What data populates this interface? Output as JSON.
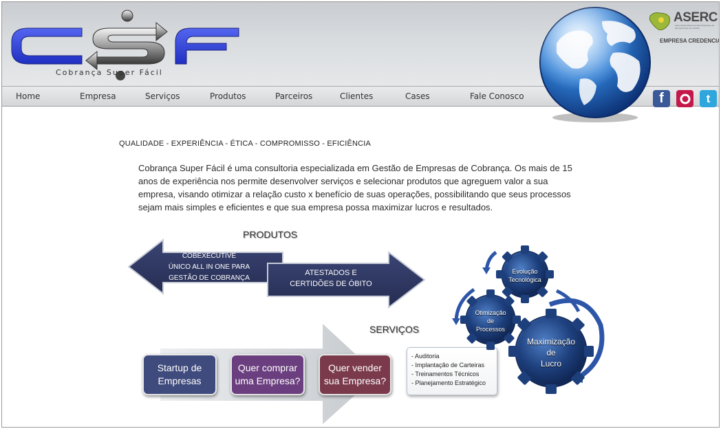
{
  "logo": {
    "letters": "CSF",
    "tagline": "Cobrança Super Fácil"
  },
  "nav": [
    {
      "label": "Home"
    },
    {
      "label": "Empresa"
    },
    {
      "label": "Serviços"
    },
    {
      "label": "Produtos"
    },
    {
      "label": "Parceiros"
    },
    {
      "label": "Clientes"
    },
    {
      "label": "Cases"
    },
    {
      "label": "Fale Conosco"
    }
  ],
  "badge": {
    "name": "ASERC",
    "subtitle": "Associação Nacional das Empresas de Recuperação de Crédito",
    "credential": "EMPRESA CREDENCIADA"
  },
  "social": [
    {
      "name": "facebook",
      "glyph": "f",
      "color": "#3b5998"
    },
    {
      "name": "orkut",
      "glyph": "o",
      "color": "#c4184a"
    },
    {
      "name": "twitter",
      "glyph": "t",
      "color": "#2fa6dc"
    }
  ],
  "tagline": "QUALIDADE - EXPERIÊNCIA - ÉTICA - COMPROMISSO - EFICIÊNCIA",
  "intro": "Cobrança Super Fácil é uma consultoria especializada em Gestão de Empresas de Cobrança. Os mais de 15 anos de experiência nos permite desenvolver serviços e selecionar produtos que agreguem valor a sua empresa, visando otimizar a relação custo x benefício de suas operações, possibilitando que seus processos sejam mais simples e eficientes e que sua empresa possa maximizar lucros e resultados.",
  "produtos": {
    "heading": "PRODUTOS",
    "left_lines": [
      "COBEXECUTIVE",
      "ÚNICO ALL IN ONE PARA",
      "GESTÃO DE COBRANÇA"
    ],
    "right_lines": [
      "ATESTADOS E",
      "CERTIDÕES DE ÓBITO"
    ]
  },
  "servicos": {
    "heading": "SERVIÇOS",
    "boxes": [
      {
        "line1": "Startup de",
        "line2": "Empresas",
        "color": "#3f4a7d"
      },
      {
        "line1": "Quer comprar",
        "line2": "uma Empresa?",
        "color": "#6b3f7f"
      },
      {
        "line1": "Quer vender",
        "line2": "sua Empresa?",
        "color": "#7a3a4c"
      }
    ],
    "list": [
      "- Auditoria",
      "- Implantação de Carteiras",
      "- Treinamentos Técnicos",
      "- Planejamento Estratégico"
    ]
  },
  "gears": {
    "top": [
      "Evolução",
      "Tecnológica"
    ],
    "middle": [
      "Otimização",
      "de",
      "Processos"
    ],
    "big": [
      "Maximização",
      "de",
      "Lucro"
    ]
  },
  "colors": {
    "logo_blue": "#2d3fd6",
    "arrow_navy": "#2c3560",
    "gear_blue": "#1d3f7c"
  }
}
